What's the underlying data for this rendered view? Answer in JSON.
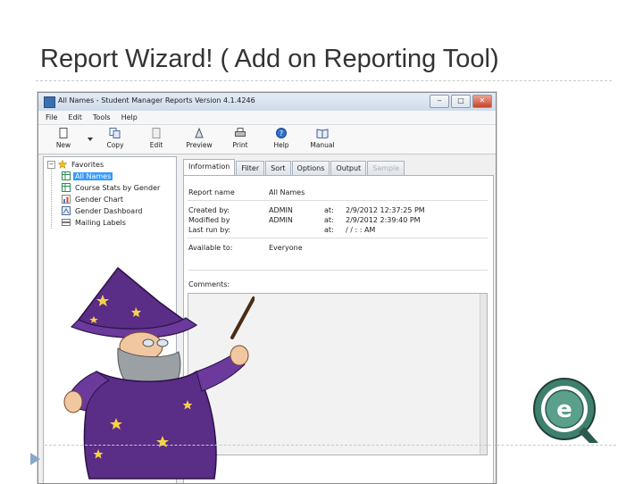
{
  "slide": {
    "title": "Report Wizard! ( Add on Reporting Tool)"
  },
  "window": {
    "title": "All Names - Student Manager Reports Version 4.1.4246",
    "controls": {
      "minimize": "‒",
      "maximize": "□",
      "close": "✕"
    },
    "menu": [
      "File",
      "Edit",
      "Tools",
      "Help"
    ],
    "toolbar": {
      "new": "New",
      "copy": "Copy",
      "edit": "Edit",
      "preview": "Preview",
      "print": "Print",
      "help": "Help",
      "manual": "Manual"
    },
    "tree": {
      "root": "Favorites",
      "items": [
        "All Names",
        "Course Stats by Gender",
        "Gender Chart",
        "Gender Dashboard",
        "Mailing Labels"
      ]
    },
    "tabs": [
      "Information",
      "Filter",
      "Sort",
      "Options",
      "Output",
      "Sample"
    ],
    "info": {
      "report_name_label": "Report name",
      "report_name_value": "All Names",
      "created_by_label": "Created by:",
      "created_by_value": "ADMIN",
      "created_at_label": "at:",
      "created_at_value": "2/9/2012 12:37:25 PM",
      "modified_by_label": "Modified by",
      "modified_by_value": "ADMIN",
      "modified_at_label": "at:",
      "modified_at_value": "2/9/2012 2:39:40 PM",
      "last_run_label": "Last run by:",
      "last_run_at_label": "at:",
      "last_run_value": "/ / : : AM",
      "available_label": "Available to:",
      "available_value": "Everyone",
      "comments_label": "Comments:"
    }
  }
}
